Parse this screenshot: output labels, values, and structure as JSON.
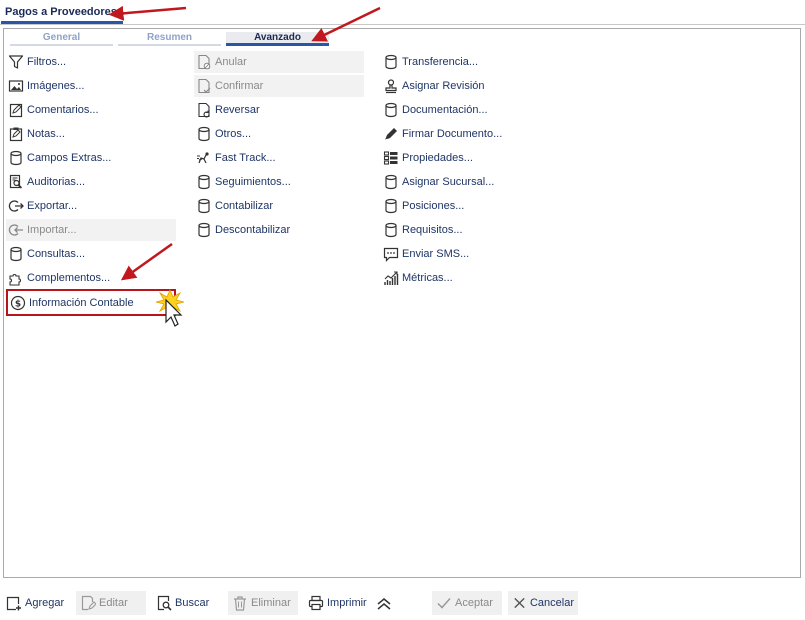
{
  "window": {
    "title": "Pagos a Proveedores"
  },
  "tabs": [
    {
      "label": "General"
    },
    {
      "label": "Resumen"
    },
    {
      "label": "Avanzado"
    }
  ],
  "col1": [
    {
      "label": "Filtros...",
      "icon": "filter-icon"
    },
    {
      "label": "Imágenes...",
      "icon": "image-icon"
    },
    {
      "label": "Comentarios...",
      "icon": "edit-note-icon"
    },
    {
      "label": "Notas...",
      "icon": "clipboard-icon"
    },
    {
      "label": "Campos Extras...",
      "icon": "database-icon"
    },
    {
      "label": "Auditorias...",
      "icon": "audit-search-icon"
    },
    {
      "label": "Exportar...",
      "icon": "export-icon"
    },
    {
      "label": "Importar...",
      "icon": "import-icon"
    },
    {
      "label": "Consultas...",
      "icon": "database-icon"
    },
    {
      "label": "Complementos...",
      "icon": "puzzle-icon"
    },
    {
      "label": "Información Contable",
      "icon": "dollar-circle-icon"
    }
  ],
  "col2": [
    {
      "label": "Anular",
      "icon": "cancel-doc-icon"
    },
    {
      "label": "Confirmar",
      "icon": "confirm-doc-icon"
    },
    {
      "label": "Reversar",
      "icon": "reverse-doc-icon"
    },
    {
      "label": "Otros...",
      "icon": "database-icon"
    },
    {
      "label": "Fast Track...",
      "icon": "fast-track-icon"
    },
    {
      "label": "Seguimientos...",
      "icon": "database-icon"
    },
    {
      "label": "Contabilizar",
      "icon": "database-icon"
    },
    {
      "label": "Descontabilizar",
      "icon": "database-icon"
    }
  ],
  "col3": [
    {
      "label": "Transferencia...",
      "icon": "database-icon"
    },
    {
      "label": "Asignar Revisión",
      "icon": "stamp-icon"
    },
    {
      "label": "Documentación...",
      "icon": "database-icon"
    },
    {
      "label": "Firmar Documento...",
      "icon": "pen-icon"
    },
    {
      "label": "Propiedades...",
      "icon": "properties-list-icon"
    },
    {
      "label": "Asignar Sucursal...",
      "icon": "database-icon"
    },
    {
      "label": "Posiciones...",
      "icon": "database-icon"
    },
    {
      "label": "Requisitos...",
      "icon": "database-icon"
    },
    {
      "label": "Enviar SMS...",
      "icon": "sms-icon"
    },
    {
      "label": "Métricas...",
      "icon": "metrics-icon"
    }
  ],
  "toolbar": {
    "add": "Agregar",
    "edit": "Editar",
    "search": "Buscar",
    "delete": "Eliminar",
    "print": "Imprimir",
    "accept": "Aceptar",
    "cancel": "Cancelar"
  },
  "colors": {
    "accent": "#2a56a8",
    "highlight": "#b8141c",
    "arrow": "#c0181e",
    "text": "#1f3566"
  }
}
